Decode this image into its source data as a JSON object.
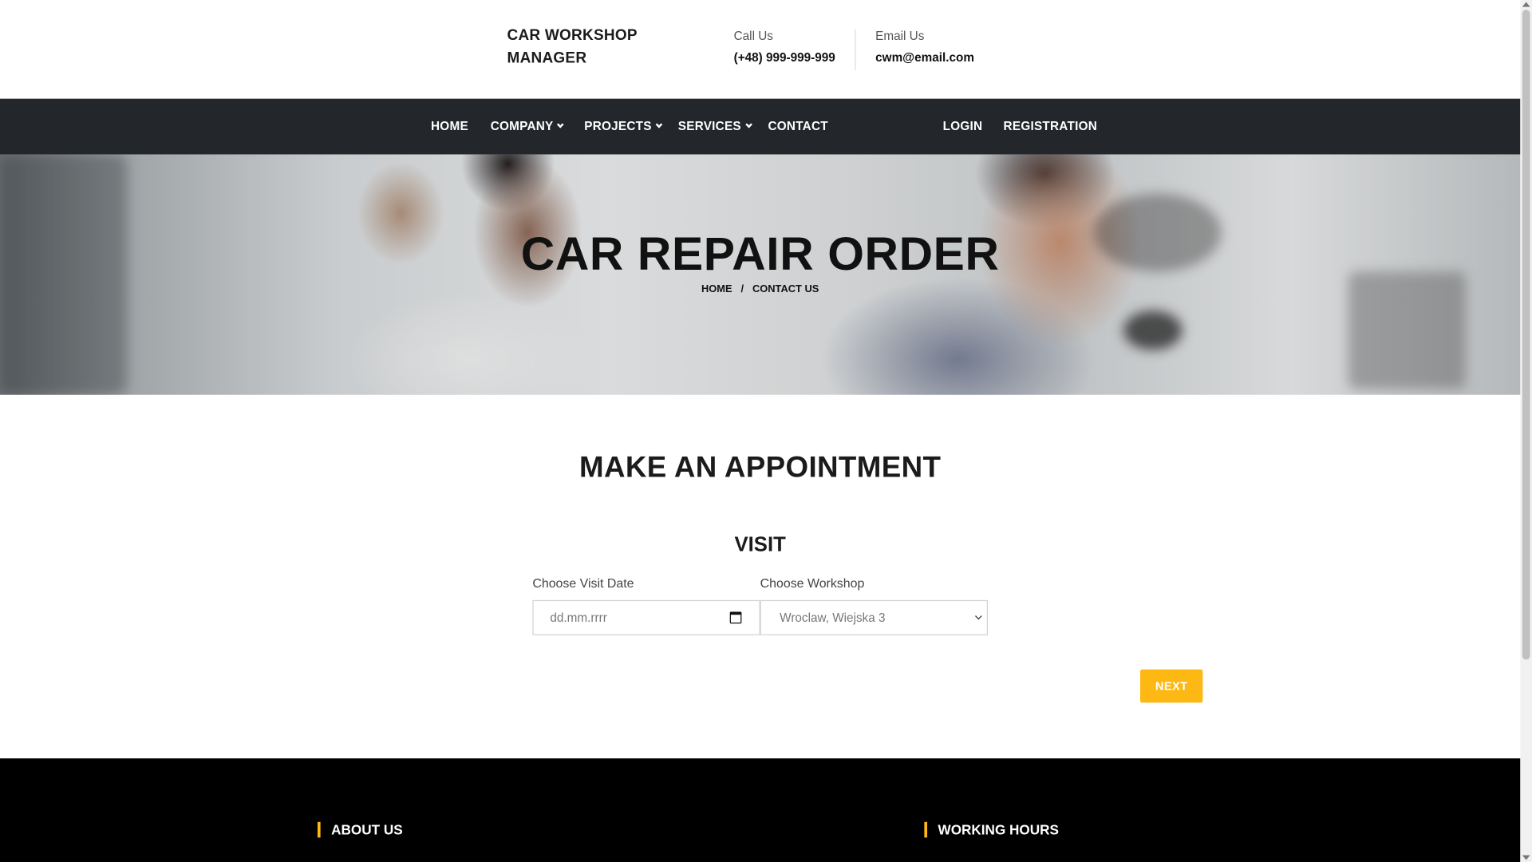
{
  "header": {
    "logo_line1": "CAR WORKSHOP",
    "logo_line2": "MANAGER",
    "call_label": "Call Us",
    "call_value": "(+48) 999-999-999",
    "email_label": "Email Us",
    "email_value": "cwm@email.com"
  },
  "nav": {
    "home": "HOME",
    "company": "COMPANY",
    "projects": "PROJECTS",
    "services": "SERVICES",
    "contact": "CONTACT",
    "login": "LOGIN",
    "registration": "REGISTRATION"
  },
  "hero": {
    "title": "CAR REPAIR ORDER",
    "crumb_home": "HOME",
    "crumb_sep": "/",
    "crumb_current": "CONTACT US"
  },
  "appointment": {
    "heading": "MAKE AN APPOINTMENT",
    "section": "VISIT",
    "date_label": "Choose Visit Date",
    "date_placeholder": "dd.mm.rrrr",
    "workshop_label": "Choose Workshop",
    "workshop_selected": "Wroclaw, Wiejska 3",
    "next_button": "NEXT"
  },
  "footer": {
    "about": "ABOUT US",
    "hours": "WORKING HOURS"
  },
  "colors": {
    "accent": "#fdb813",
    "nav_bg": "#23272b",
    "footer_bg": "#000000"
  }
}
